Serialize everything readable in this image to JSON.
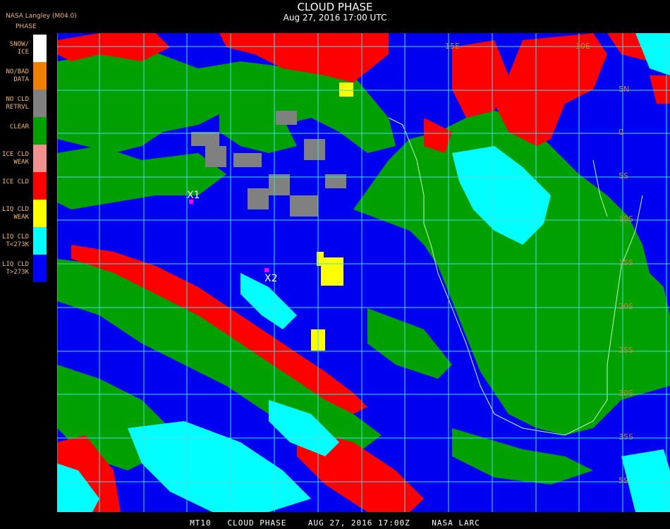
{
  "title": "CLOUD PHASE",
  "subtitle": "Aug 27, 2016 17:00 UTC",
  "source": "NASA Langley (M04.0)",
  "legend_header": "PHASE",
  "legend": [
    {
      "label": "SNOW/\nICE",
      "color": "#ffffff"
    },
    {
      "label": "NO/BAD\nDATA",
      "color": "#f08000"
    },
    {
      "label": "NO CLD\nRETRVL",
      "color": "#808080"
    },
    {
      "label": "CLEAR",
      "color": "#00a000"
    },
    {
      "label": "ICE CLD\nWEAK",
      "color": "#f09090"
    },
    {
      "label": "ICE CLD",
      "color": "#ff0000"
    },
    {
      "label": "LIQ CLD\nWEAK",
      "color": "#ffff00"
    },
    {
      "label": "LIQ CLD\nT<273K",
      "color": "#00ffff"
    },
    {
      "label": "LIQ CLD\nT>273K",
      "color": "#0000ff"
    }
  ],
  "lat_labels": [
    "5N",
    "0",
    "5S",
    "10S",
    "15S",
    "20S",
    "25S",
    "30S",
    "35S",
    "5S"
  ],
  "lon_labels": [
    "15E",
    "30E"
  ],
  "markers": [
    {
      "label": "X1",
      "color": "#ff00ff"
    },
    {
      "label": "X2",
      "color": "#ff00ff"
    }
  ],
  "footer": "MT10   CLOUD PHASE    AUG 27, 2016 17:00Z    NASA LARC"
}
